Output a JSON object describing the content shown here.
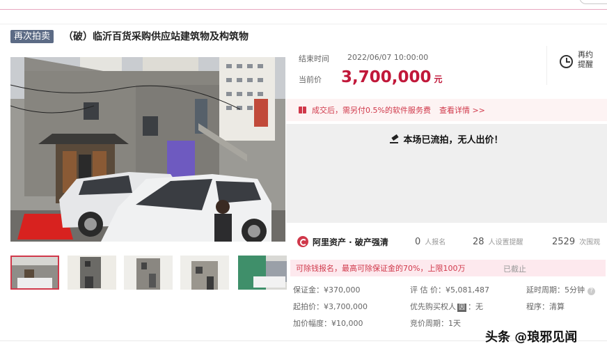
{
  "header": {
    "tag": "再次拍卖",
    "title": "（破）临沂百货采购供应站建筑物及构筑物"
  },
  "auction": {
    "end_label": "结束时间",
    "end_time": "2022/06/07 10:00:00",
    "price_label": "当前价",
    "price": "3,700,000",
    "price_unit": "元",
    "remind_label": "再约提醒"
  },
  "fee": {
    "text": "成交后，需另付0.5%的软件服务费",
    "detail_link": "查看详情 >>"
  },
  "status": {
    "text": "本场已流拍，无人出价！"
  },
  "org": {
    "name": "阿里资产 · 破产强清",
    "signups": "0",
    "signups_label": "人报名",
    "reminders": "28",
    "reminders_label": "人设置提醒",
    "views": "2529",
    "views_label": "次围观"
  },
  "deposit": {
    "text": "可除钱报名，最高可除保证金的70%，上限100万",
    "closed": "已截止"
  },
  "details": {
    "deposit_label": "保证金：",
    "deposit_value": "¥370,000",
    "appraisal_label": "评 估 价：",
    "appraisal_value": "¥5,081,487",
    "delay_label": "延时周期：",
    "delay_value": "5分钟",
    "start_label": "起拍价：",
    "start_value": "¥3,700,000",
    "priority_label": "优先购买权人",
    "priority_value": "无",
    "priority_badge": "因",
    "procedure_label": "程序：",
    "procedure_value": "清算",
    "increment_label": "加价幅度：",
    "increment_value": "¥10,000",
    "cycle_label": "竞价周期：",
    "cycle_value": "1天"
  },
  "watermark": "头条 @琅邪见闻"
}
